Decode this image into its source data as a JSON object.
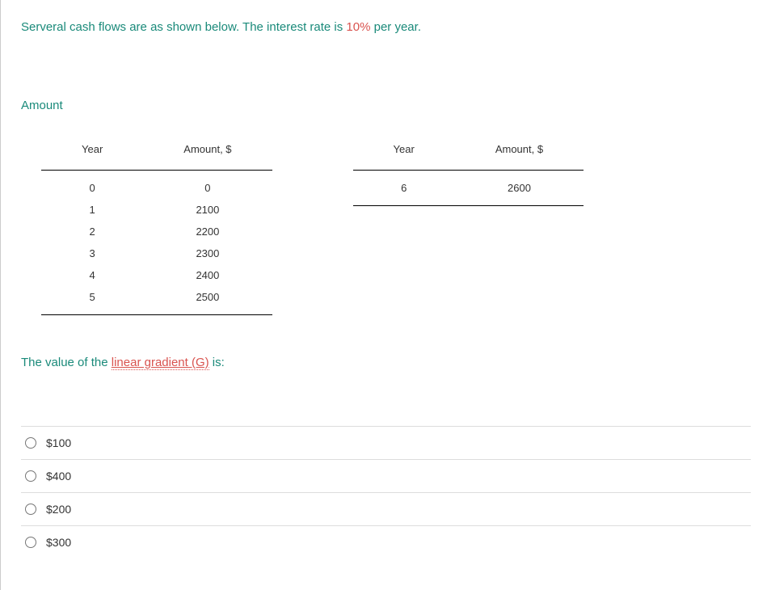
{
  "intro": {
    "prefix": "Serveral cash flows are as shown below. The interest rate is ",
    "rate": "10%",
    "suffix": " per year."
  },
  "section_label": "Amount",
  "table_left": {
    "headers": [
      "Year",
      "Amount, $"
    ],
    "rows": [
      {
        "year": "0",
        "amount": "0"
      },
      {
        "year": "1",
        "amount": "2100"
      },
      {
        "year": "2",
        "amount": "2200"
      },
      {
        "year": "3",
        "amount": "2300"
      },
      {
        "year": "4",
        "amount": "2400"
      },
      {
        "year": "5",
        "amount": "2500"
      }
    ]
  },
  "table_right": {
    "headers": [
      "Year",
      "Amount, $"
    ],
    "rows": [
      {
        "year": "6",
        "amount": "2600"
      }
    ]
  },
  "question": {
    "prefix": "The value of the ",
    "link_text": "linear gradient (G)",
    "suffix": " is:"
  },
  "options": [
    {
      "label": "$100"
    },
    {
      "label": "$400"
    },
    {
      "label": "$200"
    },
    {
      "label": "$300"
    }
  ]
}
